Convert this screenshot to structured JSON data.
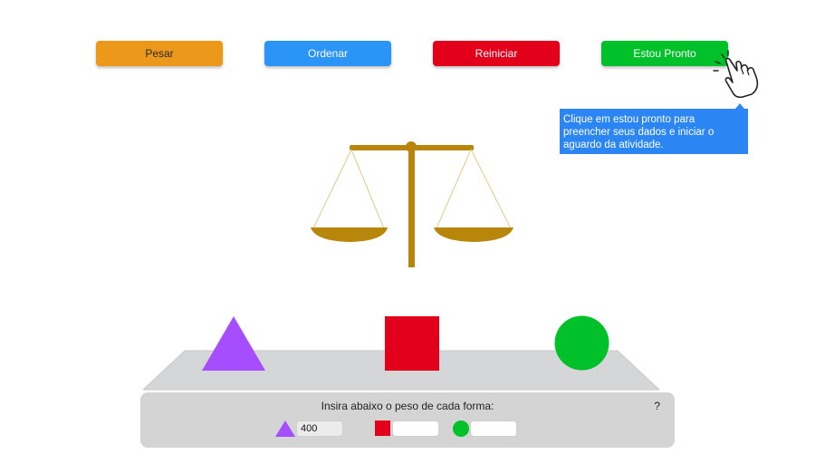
{
  "toolbar": {
    "pesar_label": "Pesar",
    "ordenar_label": "Ordenar",
    "reiniciar_label": "Reiniciar",
    "pronto_label": "Estou Pronto"
  },
  "tooltip": {
    "text": "Clique em estou pronto para preencher seus dados e iniciar o aguardo da atividade."
  },
  "scale": {
    "color": "#b8860b"
  },
  "shapes": [
    {
      "name": "triangle",
      "color": "#a64dff"
    },
    {
      "name": "square",
      "color": "#e2001a"
    },
    {
      "name": "circle",
      "color": "#00c12a"
    }
  ],
  "panel": {
    "title": "Insira abaixo o peso de cada forma:",
    "help": "?",
    "inputs": [
      {
        "shape": "triangle",
        "value": "400"
      },
      {
        "shape": "square",
        "value": ""
      },
      {
        "shape": "circle",
        "value": ""
      }
    ]
  }
}
